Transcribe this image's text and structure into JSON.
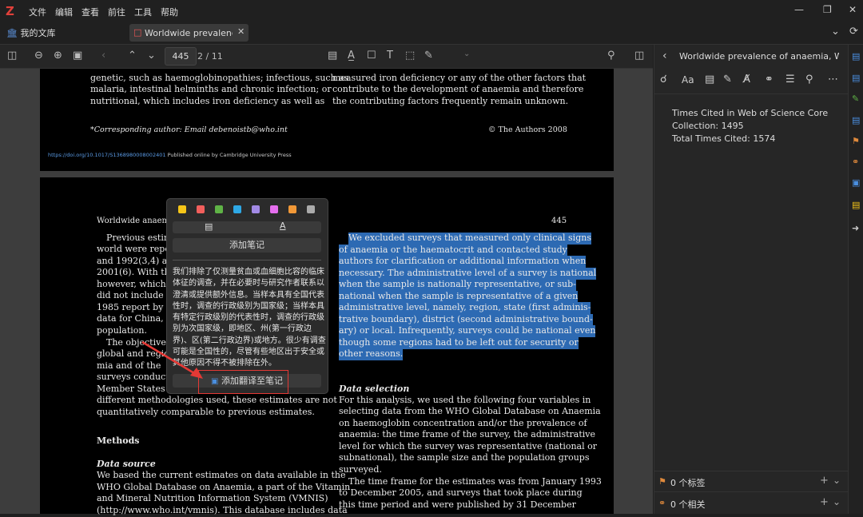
{
  "app": {
    "logo": "Z"
  },
  "menu": [
    "文件",
    "编辑",
    "查看",
    "前往",
    "工具",
    "帮助"
  ],
  "tabs": {
    "library": "我的文库",
    "document": "Worldwide prevalence o"
  },
  "toolbar": {
    "page_value": "445",
    "page_total": "2 / 11"
  },
  "pdf": {
    "page1_left": [
      "genetic, such as haemoglobinopathies; infectious, such as",
      "malaria, intestinal helminths and chronic infection; or",
      "nutritional, which includes iron deficiency as well as"
    ],
    "page1_right": [
      "measured iron deficiency or any of the other factors that",
      "contribute to the development of anaemia and therefore",
      "the contributing factors frequently remain unknown."
    ],
    "corresponding": "*Corresponding author: Email debenoistb@who.int",
    "copyright": "© The Authors 2008",
    "doi": "https://doi.org/10.1017/S1368980008002401",
    "doi_suffix": "Published online by Cambridge University Press",
    "page2_header_left": "Worldwide anaemi",
    "page2_number": "445",
    "page2_left": [
      "Previous estima",
      "world were repo",
      "and 1992(3,4) and",
      "2001(6). With the",
      "however, which in",
      "did not include d",
      "1985 report by De",
      "data for China,",
      "population.",
      "The objective o",
      "global and regio",
      "mia and of the",
      "surveys conducte",
      "Member States o"
    ],
    "page2_left_full": [
      "different methodologies used, these estimates are not",
      "quantitatively comparable to previous estimates."
    ],
    "methods": "Methods",
    "data_source": "Data source",
    "data_source_text": [
      "We based the current estimates on data available in the",
      "WHO Global Database on Anaemia, a part of the Vitamin",
      "and Mineral Nutrition Information System (VMNIS)",
      "(http://www.who.int/vmnis). This database includes data"
    ],
    "highlight": [
      "We excluded surveys that measured only clinical signs",
      "of anaemia or the haematocrit and contacted study",
      "authors for clarification or additional information when",
      "necessary. The administrative level of a survey is national",
      "when the sample is nationally representative, or sub-",
      "national when the sample is representative of a given",
      "administrative level, namely, region, state (first adminis-",
      "trative boundary), district (second administrative bound-",
      "ary) or local. Infrequently, surveys could be national even",
      "though some regions had to be left out for security or",
      "other reasons."
    ],
    "data_selection": "Data selection",
    "data_selection_text": [
      "For this analysis, we used the following four variables in",
      "selecting data from the WHO Global Database on Anaemia",
      "on haemoglobin concentration and/or the prevalence of",
      "anaemia: the time frame of the survey, the administrative",
      "level for which the survey was representative (national or",
      "subnational), the sample size and the population groups",
      "surveyed.",
      "The time frame for the estimates was from January 1993",
      "to December 2005, and surveys that took place during",
      "this time period and were published by 31 December"
    ]
  },
  "popup": {
    "colors": [
      "#f5c518",
      "#f25f5c",
      "#5fb346",
      "#2ea8e5",
      "#a28ae5",
      "#e56eee",
      "#f19837",
      "#aaaaaa"
    ],
    "add_note": "添加笔记",
    "translation": "我们排除了仅测量贫血或血细胞比容的临床\n体征的调查，并在必要时与研究作者联系以\n澄清或提供额外信息。当样本具有全国代表\n性时，调查的行政级别为国家级；当样本具\n有特定行政级别的代表性时，调查的行政级\n别为次国家级，即地区、州(第一行政边\n界)、区(第二行政边界)或地方。很少有调查\n可能是全国性的，尽管有些地区出于安全或\n其他原因不得不被排除在外。",
    "add_translation": "添加翻译至笔记"
  },
  "right_panel": {
    "title": "Worldwide prevalence of anaemia, WHO ...",
    "cited_line1": "Times Cited in Web of Science Core",
    "cited_line2": "Collection:  1495",
    "cited_line3": "Total Times Cited:  1574",
    "tags": "0 个标签",
    "related": "0 个相关"
  }
}
